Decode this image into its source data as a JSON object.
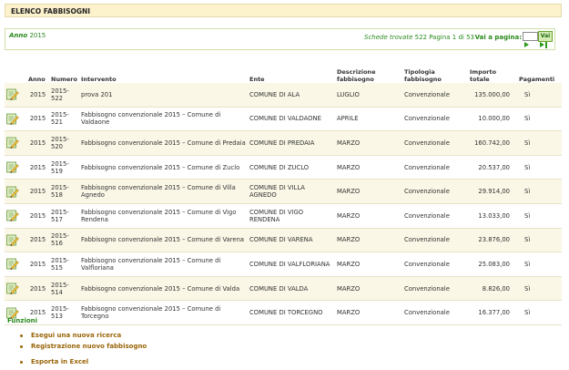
{
  "header": {
    "title": "ELENCO FABBISOGNI"
  },
  "filters": {
    "anno_label": "Anno",
    "anno_value": "2015"
  },
  "pager": {
    "schede_label": "Schede trovate",
    "schede_count": "522",
    "pagina_text": "Pagina 1 di 53",
    "vai_label": "Vai a pagina:",
    "vai_button": "Vai",
    "page_input": ""
  },
  "table": {
    "columns": [
      "Anno",
      "Numero",
      "Intervento",
      "Ente",
      "Descrizione fabbisogno",
      "Tipologia fabbisogno",
      "Importo totale",
      "Pagamenti"
    ],
    "rows": [
      {
        "anno": "2015",
        "numero": "2015-522",
        "intervento": "prova 201",
        "ente": "COMUNE DI ALA",
        "descrizione": "LUGLIO",
        "tipologia": "Convenzionale",
        "importo": "135.000,00",
        "pagamenti": "Sì"
      },
      {
        "anno": "2015",
        "numero": "2015-521",
        "intervento": "Fabbisogno convenzionale 2015 – Comune di Valdaone",
        "ente": "COMUNE DI VALDAONE",
        "descrizione": "APRILE",
        "tipologia": "Convenzionale",
        "importo": "10.000,00",
        "pagamenti": "Sì"
      },
      {
        "anno": "2015",
        "numero": "2015-520",
        "intervento": "Fabbisogno convenzionale 2015 – Comune di Predaia",
        "ente": "COMUNE DI PREDAIA",
        "descrizione": "MARZO",
        "tipologia": "Convenzionale",
        "importo": "160.742,00",
        "pagamenti": "Sì"
      },
      {
        "anno": "2015",
        "numero": "2015-519",
        "intervento": "Fabbisogno convenzionale 2015 – Comune di Zuclo",
        "ente": "COMUNE DI ZUCLO",
        "descrizione": "MARZO",
        "tipologia": "Convenzionale",
        "importo": "20.537,00",
        "pagamenti": "Sì"
      },
      {
        "anno": "2015",
        "numero": "2015-518",
        "intervento": "Fabbisogno convenzionale 2015 – Comune di Villa Agnedo",
        "ente": "COMUNE DI VILLA AGNEDO",
        "descrizione": "MARZO",
        "tipologia": "Convenzionale",
        "importo": "29.914,00",
        "pagamenti": "Sì"
      },
      {
        "anno": "2015",
        "numero": "2015-517",
        "intervento": "Fabbisogno convenzionale 2015 – Comune di Vigo Rendena",
        "ente": "COMUNE DI VIGO RENDENA",
        "descrizione": "MARZO",
        "tipologia": "Convenzionale",
        "importo": "13.033,00",
        "pagamenti": "Sì"
      },
      {
        "anno": "2015",
        "numero": "2015-516",
        "intervento": "Fabbisogno convenzionale 2015 – Comune di Varena",
        "ente": "COMUNE DI VARENA",
        "descrizione": "MARZO",
        "tipologia": "Convenzionale",
        "importo": "23.876,00",
        "pagamenti": "Sì"
      },
      {
        "anno": "2015",
        "numero": "2015-515",
        "intervento": "Fabbisogno convenzionale 2015 – Comune di Valfloriana",
        "ente": "COMUNE DI VALFLORIANA",
        "descrizione": "MARZO",
        "tipologia": "Convenzionale",
        "importo": "25.083,00",
        "pagamenti": "Sì"
      },
      {
        "anno": "2015",
        "numero": "2015-514",
        "intervento": "Fabbisogno convenzionale 2015 – Comune di Valda",
        "ente": "COMUNE DI VALDA",
        "descrizione": "MARZO",
        "tipologia": "Convenzionale",
        "importo": "8.826,00",
        "pagamenti": "Sì"
      },
      {
        "anno": "2015",
        "numero": "2015-513",
        "intervento": "Fabbisogno convenzionale 2015 – Comune di Torcegno",
        "ente": "COMUNE DI TORCEGNO",
        "descrizione": "MARZO",
        "tipologia": "Convenzionale",
        "importo": "16.377,00",
        "pagamenti": "Sì"
      }
    ],
    "row_icon": "edit-document-icon"
  },
  "funzioni": {
    "title": "Funzioni",
    "links": [
      "Esegui una nuova ricerca",
      "Registrazione nuovo fabbisogno",
      "Esporta in Excel"
    ]
  },
  "colors": {
    "accent_green": "#2b8a1e",
    "header_bg": "#fcf3cd",
    "link_brown": "#9a6508",
    "row_alt": "#faf7e6"
  }
}
